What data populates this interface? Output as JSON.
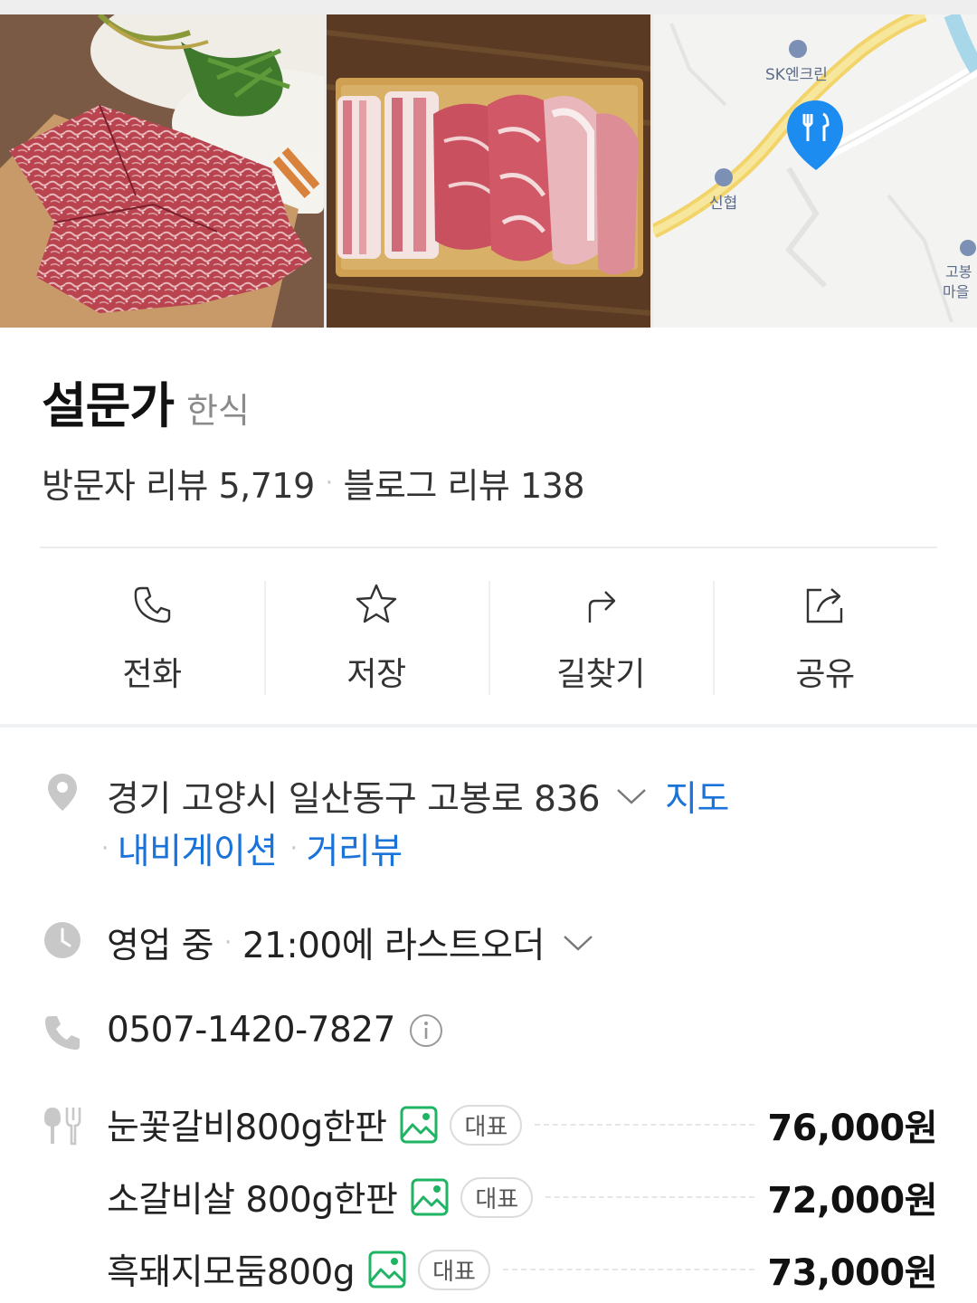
{
  "photos": [
    {
      "alt": "marbled-beef-on-board",
      "name": "photo-beef"
    },
    {
      "alt": "pork-cuts-on-tray",
      "name": "photo-pork"
    },
    {
      "alt": "map-thumbnail",
      "name": "photo-map"
    }
  ],
  "map": {
    "gas_station_label": "SK엔크린",
    "bank_label": "신협",
    "side_label_1": "고봉",
    "side_label_2": "마을"
  },
  "place": {
    "name": "설문가",
    "category": "한식",
    "visitor_reviews": "방문자 리뷰 5,719",
    "blog_reviews": "블로그 리뷰 138",
    "separator": "·"
  },
  "actions": [
    {
      "label": "전화",
      "icon": "phone-icon"
    },
    {
      "label": "저장",
      "icon": "star-icon"
    },
    {
      "label": "길찾기",
      "icon": "directions-icon"
    },
    {
      "label": "공유",
      "icon": "share-icon"
    }
  ],
  "address": {
    "text": "경기 고양시 일산동구 고봉로 836",
    "map_link": "지도",
    "navigation_link": "내비게이션",
    "street_view_link": "거리뷰",
    "separator": "·"
  },
  "hours": {
    "status": "영업 중",
    "separator": "·",
    "last_order": "21:00에 라스트오더"
  },
  "phone": {
    "number": "0507-1420-7827"
  },
  "menu": [
    {
      "name": "눈꽃갈비800g한판",
      "badge": "대표",
      "price": "76,000원"
    },
    {
      "name": "소갈비살 800g한판",
      "badge": "대표",
      "price": "72,000원"
    },
    {
      "name": "흑돼지모둠800g",
      "badge": "대표",
      "price": "73,000원"
    }
  ],
  "colors": {
    "link": "#1a73d9",
    "map_pin": "#1c8cf0",
    "image_icon": "#1fb463",
    "muted_icon": "#c8c8c8"
  }
}
